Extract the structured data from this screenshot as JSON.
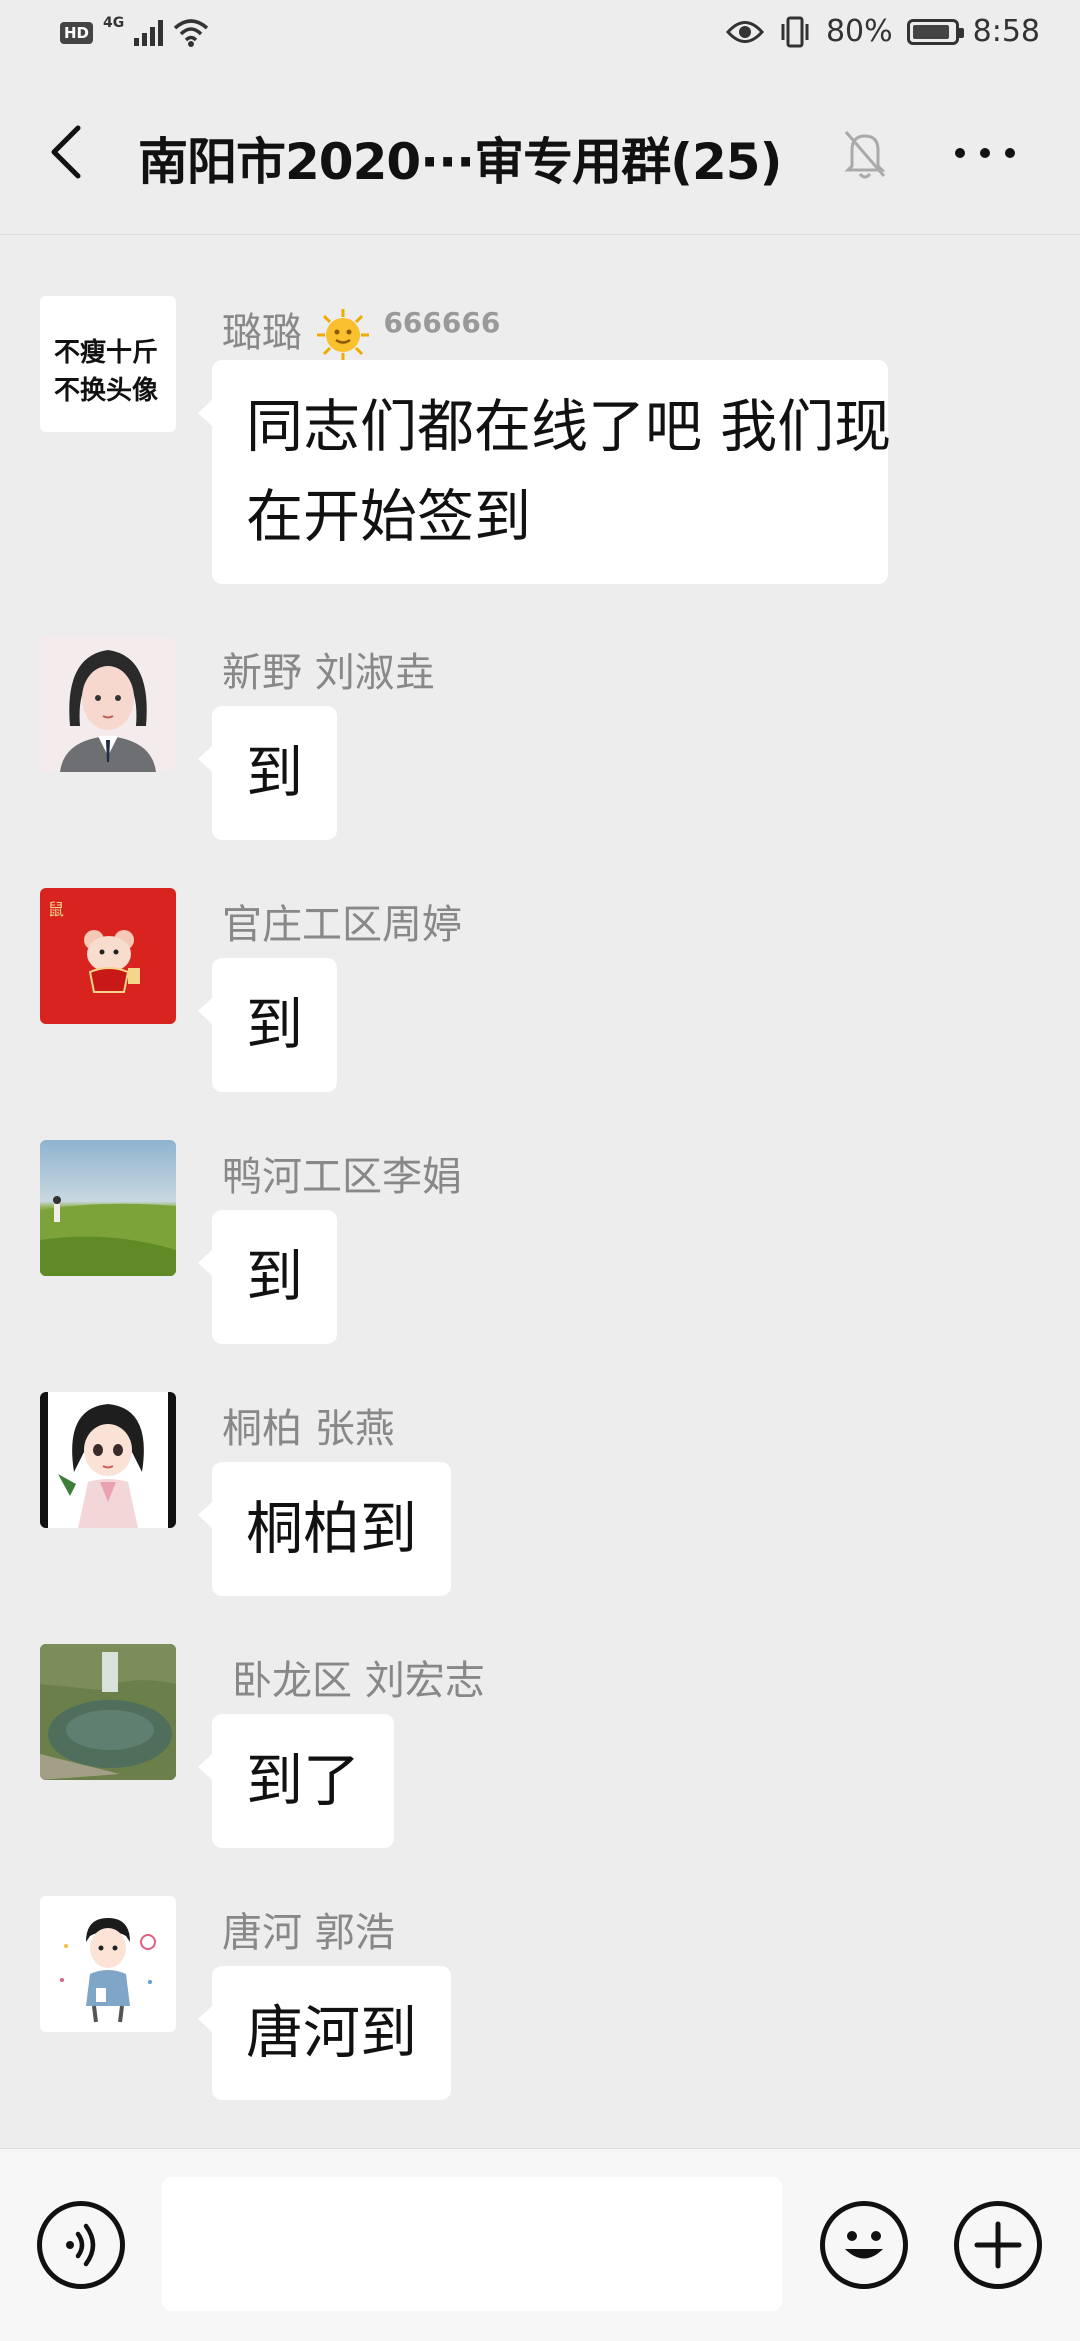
{
  "status_bar": {
    "hd": "HD",
    "network": "4G",
    "battery_percent": "80%",
    "time": "8:58"
  },
  "header": {
    "title": "南阳市2020···审专用群(25)"
  },
  "avatars": {
    "lulu_text_line1": "不瘦十斤",
    "lulu_text_line2": "不换头像",
    "red_tag": "鼠"
  },
  "messages": [
    {
      "sender": "璐璐",
      "sender_suffix": "666666",
      "text_line1": "同志们都在线了吧 我们现",
      "text_line2": "在开始签到"
    },
    {
      "sender": "新野 刘淑垚",
      "text": "到"
    },
    {
      "sender": "官庄工区周婷",
      "text": "到"
    },
    {
      "sender": "鸭河工区李娟",
      "text": "到"
    },
    {
      "sender": "桐柏 张燕",
      "text": "桐柏到"
    },
    {
      "sender": "卧龙区 刘宏志",
      "text": "到了"
    },
    {
      "sender": "唐河 郭浩",
      "text": "唐河到"
    }
  ],
  "input_bar": {
    "placeholder": ""
  },
  "colors": {
    "background": "#ededed",
    "bubble": "#ffffff",
    "sender_name": "#888888"
  }
}
